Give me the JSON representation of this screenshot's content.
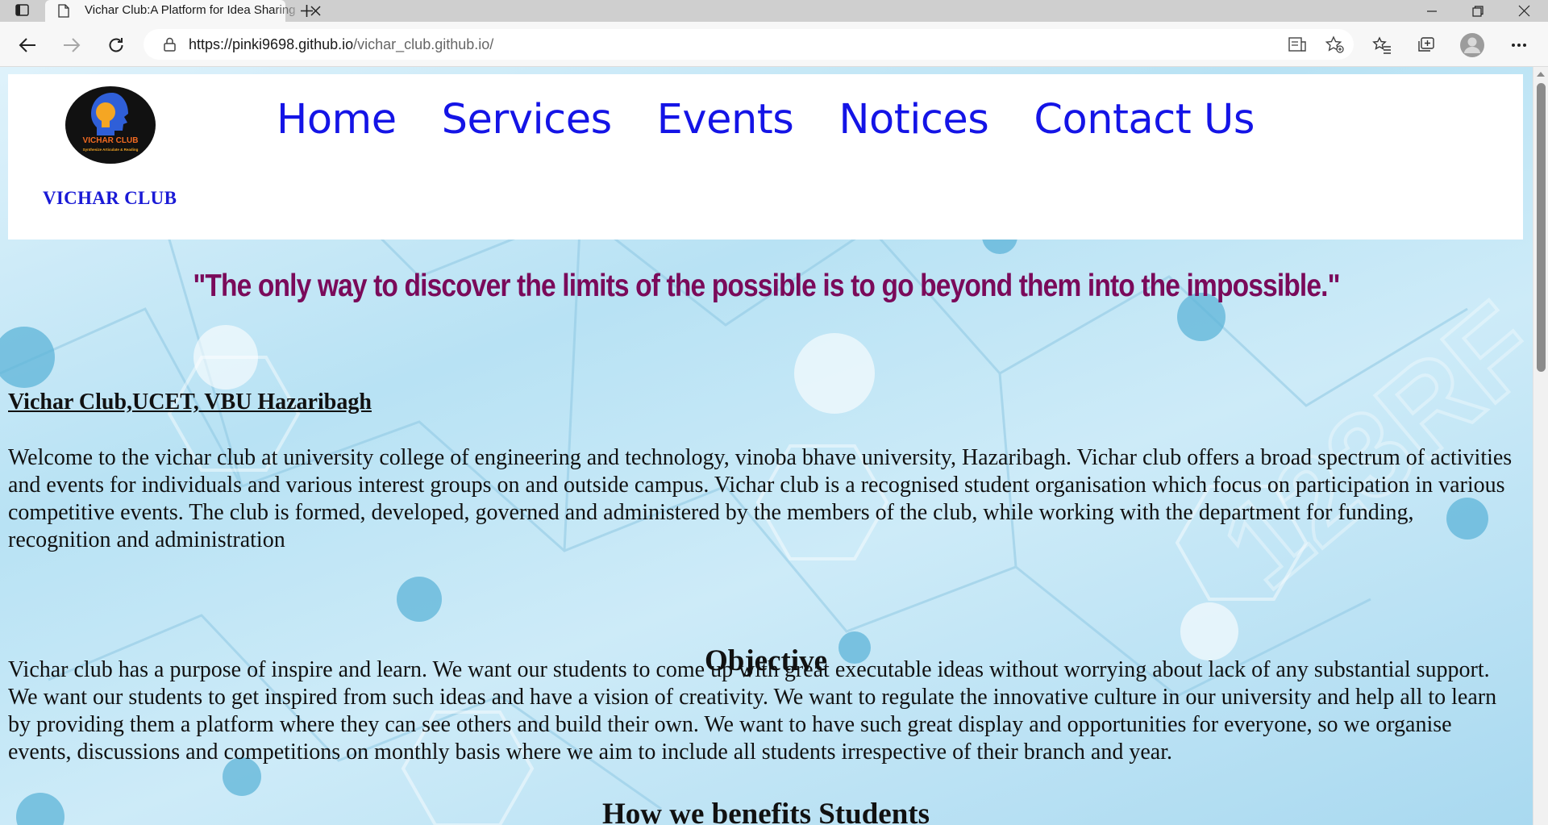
{
  "browser": {
    "tab_title": "Vichar Club:A Platform for Idea Sharing",
    "url_host": "https://pinki9698.github.io",
    "url_path": "/vichar_club.github.io/"
  },
  "header": {
    "logo_text": "VICHAR CLUB",
    "logo_tagline": "Synthesize Articulate & Reading",
    "club_name": "VICHAR CLUB",
    "nav": [
      {
        "label": "Home"
      },
      {
        "label": "Services"
      },
      {
        "label": "Events"
      },
      {
        "label": "Notices"
      },
      {
        "label": "Contact Us"
      }
    ]
  },
  "main": {
    "quote": "\"The only way to discover the limits of the possible is to go beyond them into the impossible.\"",
    "about_heading": "Vichar Club,UCET, VBU Hazaribagh",
    "about_text": "Welcome to the vichar club at university college of engineering and technology, vinoba bhave university, Hazaribagh. Vichar club offers a broad spectrum of activities and events for individuals and various interest groups on and outside campus. Vichar club is a recognised student organisation which focus on participation in various competitive events. The club is formed, developed, governed and administered by the members of the club, while working with the department for funding, recognition and administration",
    "objective_heading": "Objective",
    "objective_text": "Vichar club has a purpose of inspire and learn. We want our students to come up with great executable ideas without worrying about lack of any substantial support. We want our students to get inspired from such ideas and have a vision of creativity. We want to regulate the innovative culture in our university and help all to learn by providing them a platform where they can see others and build their own. We want to have such great display and opportunities for everyone, so we organise events, discussions and competitions on monthly basis where we aim to include all students irrespective of their branch and year.",
    "benefits_heading": "How we benefits Students"
  }
}
